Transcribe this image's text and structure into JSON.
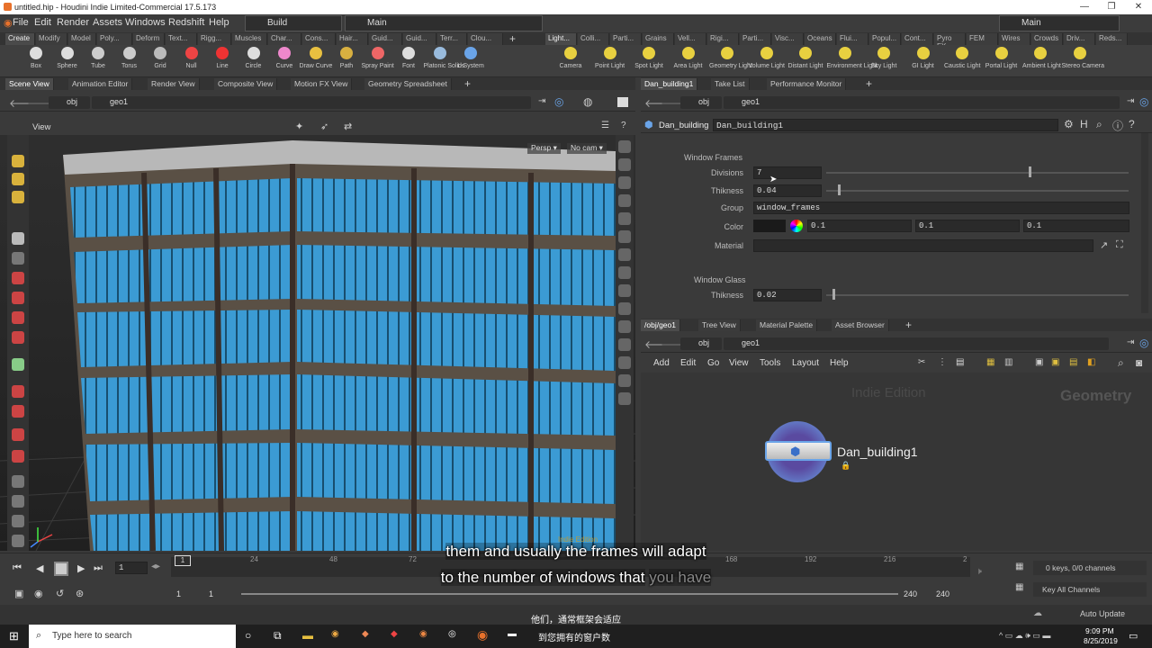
{
  "window": {
    "title": "untitled.hip - Houdini Indie Limited-Commercial 17.5.173"
  },
  "menubar": {
    "items": [
      "File",
      "Edit",
      "Render",
      "Assets",
      "Windows",
      "Redshift",
      "Help"
    ],
    "desktop": "Build",
    "runtime": "Main",
    "right_desktop": "Main"
  },
  "shelf_tabs_left": [
    "Create",
    "Modify",
    "Model",
    "Poly...",
    "Deform",
    "Text...",
    "Rigg...",
    "Muscles",
    "Char...",
    "Cons...",
    "Hair...",
    "Guid...",
    "Guid...",
    "Terr...",
    "Clou..."
  ],
  "shelf_tabs_right": [
    "Light...",
    "Colli...",
    "Parti...",
    "Grains",
    "Vell...",
    "Rigi...",
    "Parti...",
    "Visc...",
    "Oceans",
    "Flui...",
    "Popul...",
    "Cont...",
    "Pyro FX",
    "FEM",
    "Wires",
    "Crowds",
    "Driv...",
    "Reds..."
  ],
  "tools_left": [
    "Box",
    "Sphere",
    "Tube",
    "Torus",
    "Grid",
    "Null",
    "Line",
    "Circle",
    "Curve",
    "Draw Curve",
    "Path",
    "Spray Paint",
    "Font",
    "Platonic Solids",
    "L-System"
  ],
  "tools_right": [
    "Camera",
    "Point Light",
    "Spot Light",
    "Area Light",
    "Geometry Light",
    "Volume Light",
    "Distant Light",
    "Environment Light",
    "Sky Light",
    "GI Light",
    "Caustic Light",
    "Portal Light",
    "Ambient Light",
    "Stereo Camera"
  ],
  "left_pane": {
    "tabs": [
      "Scene View",
      "Animation Editor",
      "Render View",
      "Composite View",
      "Motion FX View",
      "Geometry Spreadsheet"
    ],
    "path_obj": "obj",
    "path_geo": "geo1",
    "view_label": "View",
    "persp": "Persp",
    "cam": "No cam",
    "watermark": "Indie Edition"
  },
  "params_pane": {
    "tabs": [
      "Dan_building1",
      "Take List",
      "Performance Monitor"
    ],
    "path_obj": "obj",
    "path_geo": "geo1",
    "node_type": "Dan_building",
    "node_name": "Dan_building1",
    "section1": "Window Frames",
    "divisions_label": "Divisions",
    "divisions_value": "7",
    "divisions_fraction": 0.67,
    "thickness_label": "Thikness",
    "thickness_value": "0.04",
    "thickness_fraction": 0.04,
    "group_label": "Group",
    "group_value": "window_frames",
    "color_label": "Color",
    "color_r": "0.1",
    "color_g": "0.1",
    "color_b": "0.1",
    "material_label": "Material",
    "section2": "Window Glass",
    "glass_thickness_label": "Thikness",
    "glass_thickness_value": "0.02",
    "glass_thickness_fraction": 0.02
  },
  "network_pane": {
    "tabs": [
      "/obj/geo1",
      "Tree View",
      "Material Palette",
      "Asset Browser"
    ],
    "path_obj": "obj",
    "path_geo": "geo1",
    "menu": [
      "Add",
      "Edit",
      "Go",
      "View",
      "Tools",
      "Layout",
      "Help"
    ],
    "watermark": "Indie Edition",
    "context": "Geometry",
    "node_label": "Dan_building1"
  },
  "timeline": {
    "frame": "1",
    "ticks": [
      "1",
      "24",
      "48",
      "72",
      "168",
      "192",
      "216",
      "2"
    ],
    "start": "1",
    "start2": "1",
    "end": "240",
    "end2": "240",
    "keys": "0 keys, 0/0 channels",
    "key_all": "Key All Channels",
    "auto_update": "Auto Update"
  },
  "subtitles": {
    "line1": "them and usually the frames will adapt",
    "line2a": "to the number of windows that",
    "line2b": "you have",
    "cn1": "他们，通常框架会适应",
    "cn2": "到您拥有的窗户数"
  },
  "taskbar": {
    "search_placeholder": "Type here to search",
    "time": "9:09 PM",
    "date": "8/25/2019"
  }
}
